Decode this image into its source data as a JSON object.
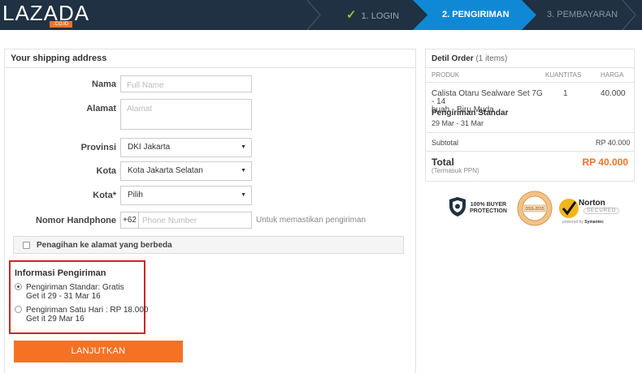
{
  "brand": {
    "logo_main": "LAZADA",
    "logo_sub": ".CO.ID",
    "orange": "#f57224",
    "navy": "#1f3142",
    "blue": "#0f89d6"
  },
  "steps": [
    {
      "label": "1. LOGIN",
      "state": "done"
    },
    {
      "label": "2. PENGIRIMAN",
      "state": "active"
    },
    {
      "label": "3. PEMBAYARAN",
      "state": "pending"
    }
  ],
  "address": {
    "title": "Your shipping address",
    "nama_label": "Nama",
    "nama_placeholder": "Full Name",
    "alamat_label": "Alamat",
    "alamat_placeholder": "Alamat",
    "provinsi_label": "Provinsi",
    "provinsi_value": "DKI Jakarta",
    "kota_label": "Kota",
    "kota_value": "Kota Jakarta Selatan",
    "kota2_label": "Kota*",
    "kota2_value": "Pilih",
    "phone_label": "Nomor Handphone",
    "phone_prefix": "+62",
    "phone_placeholder": "Phone Number",
    "phone_hint": "Untuk memastikan pengiriman",
    "billing_label": "Penagihan ke alamat yang berbeda"
  },
  "shipping": {
    "title": "Informasi Pengiriman",
    "options": [
      {
        "line1": "Pengiriman Standar: Gratis",
        "line2": "Get it 29 - 31 Mar 16",
        "selected": true
      },
      {
        "line1": "Pengiriman Satu Hari : RP 18.000",
        "line2": "Get it 29 Mar 16",
        "selected": false
      }
    ]
  },
  "cta_label": "LANJUTKAN",
  "order": {
    "title": "Detil Order",
    "count": "(1 items)",
    "col_produk": "PRODUK",
    "col_qty": "KUANTITAS",
    "col_harga": "HARGA",
    "product_line1": "Calista Otaru Sealware Set 7G - 14",
    "product_line2": "buah - Biru Muda",
    "qty": "1",
    "price": "40.000",
    "ship_name": "Pengiriman Standar",
    "ship_dates": "29 Mar - 31 Mar",
    "subtotal_label": "Subtotal",
    "subtotal_value": "RP 40.000",
    "total_label": "Total",
    "total_sub": "(Termasuk PPN)",
    "total_value": "RP 40.000"
  },
  "badges": {
    "buyer_line1": "100% BUYER",
    "buyer_line2": "PROTECTION",
    "seal_text": "DSS-2015",
    "norton_name": "Norton",
    "norton_sub": "SECURED",
    "norton_powered": "powered by",
    "norton_vendor": "Symantec"
  }
}
